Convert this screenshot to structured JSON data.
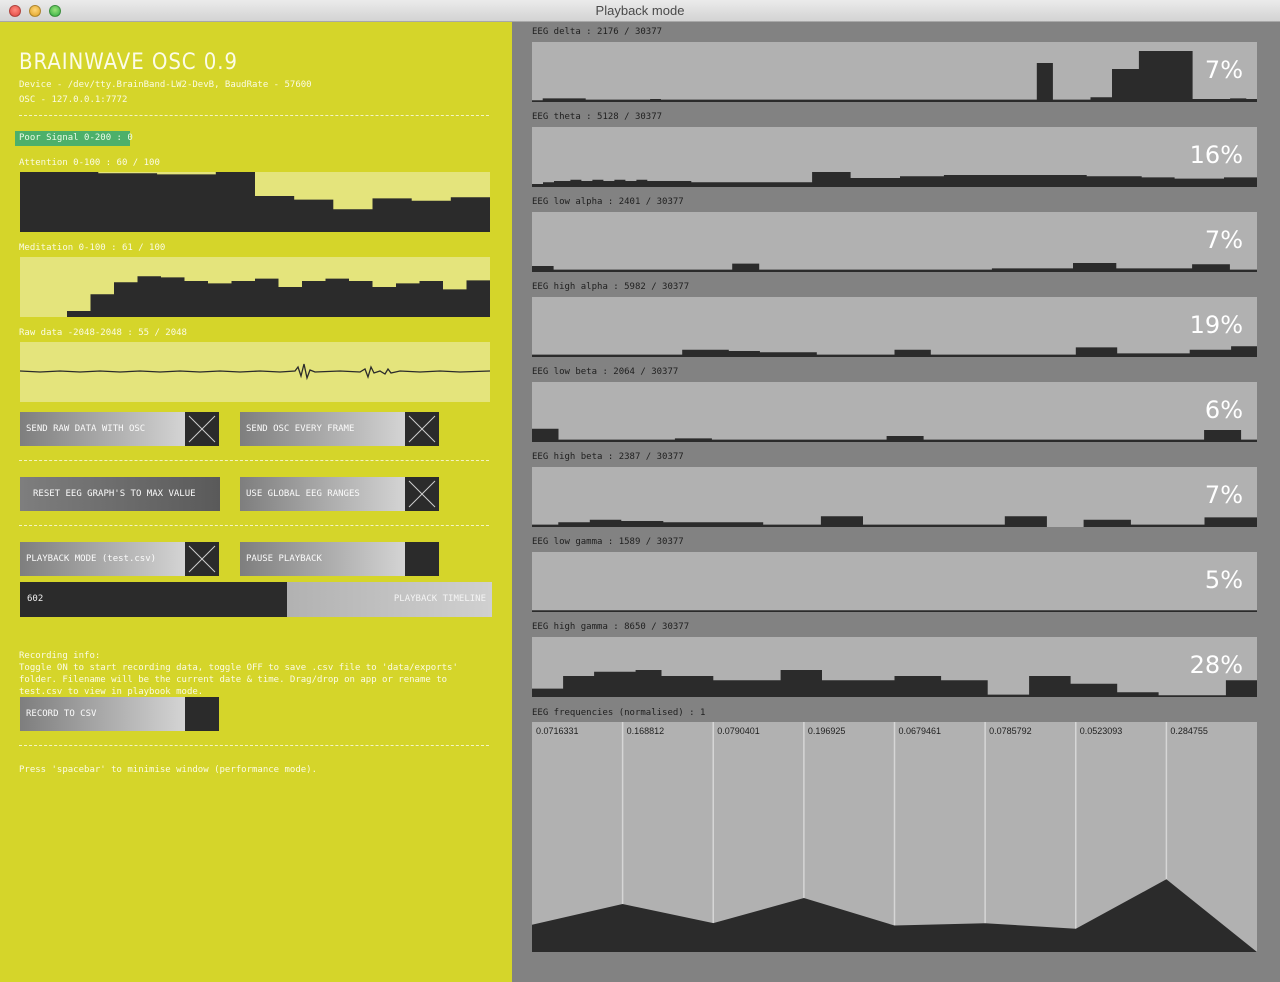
{
  "window": {
    "title": "Playback mode"
  },
  "app": {
    "title": "BRAINWAVE OSC 0.9",
    "device": "Device - /dev/tty.BrainBand-LW2-DevB, BaudRate - 57600",
    "osc": "OSC - 127.0.0.1:7772"
  },
  "poor_signal": "Poor Signal 0-200 : 0",
  "attention": {
    "label": "Attention 0-100 : 60 / 100",
    "values": [
      100,
      100,
      100,
      100,
      98,
      98,
      98,
      96,
      96,
      96,
      100,
      100,
      60,
      60,
      54,
      54,
      38,
      38,
      56,
      56,
      52,
      52,
      58,
      58
    ]
  },
  "meditation": {
    "label": "Meditation 0-100 : 61 / 100",
    "values": [
      0,
      0,
      0,
      0,
      10,
      10,
      38,
      38,
      58,
      58,
      68,
      68,
      66,
      66,
      60,
      60,
      56,
      56,
      60,
      60,
      64,
      64,
      50,
      50,
      60,
      60,
      64,
      64,
      60,
      60,
      50,
      50,
      56,
      56,
      60,
      60,
      46,
      46,
      61,
      61
    ]
  },
  "raw": {
    "label": "Raw data -2048-2048 : 55 / 2048"
  },
  "buttons": {
    "send_raw": "SEND RAW DATA WITH OSC",
    "send_every_frame": "SEND OSC EVERY FRAME",
    "reset_eeg": "RESET EEG GRAPH'S TO MAX VALUE",
    "global_ranges": "USE GLOBAL EEG RANGES",
    "playback_mode": "PLAYBACK MODE (test.csv)",
    "pause_playback": "PAUSE PLAYBACK",
    "record_csv": "RECORD TO CSV"
  },
  "toggles": {
    "send_raw": true,
    "send_every_frame": true,
    "global_ranges": true,
    "playback_mode": true,
    "pause_playback": false,
    "record_csv": false
  },
  "timeline": {
    "value": "602",
    "label": "PLAYBACK TIMELINE",
    "progress": 0.565
  },
  "recording": {
    "title": "Recording info:",
    "text": "Toggle ON to start recording data, toggle OFF to save .csv file to 'data/exports' folder. Filename will be the current date & time. Drag/drop on app or rename to test.csv to view in playbook mode."
  },
  "footer": "Press 'spacebar' to minimise window (performance mode).",
  "eeg": [
    {
      "label": "EEG delta : 2176 / 30377",
      "percent": "7%",
      "values": [
        3,
        3,
        6,
        6,
        6,
        6,
        6,
        6,
        6,
        6,
        4,
        4,
        4,
        4,
        4,
        4,
        4,
        4,
        4,
        4,
        4,
        4,
        5,
        5,
        4,
        4,
        4,
        4,
        4,
        4,
        4,
        4,
        4,
        4,
        4,
        4,
        4,
        4,
        4,
        4,
        4,
        4,
        4,
        4,
        4,
        4,
        4,
        4,
        4,
        4,
        4,
        4,
        4,
        4,
        4,
        4,
        4,
        4,
        4,
        4,
        4,
        4,
        4,
        4,
        4,
        4,
        4,
        4,
        4,
        4,
        4,
        4,
        4,
        4,
        4,
        4,
        4,
        4,
        4,
        4,
        4,
        4,
        4,
        4,
        4,
        4,
        4,
        4,
        4,
        4,
        4,
        4,
        4,
        4,
        65,
        65,
        65,
        4,
        4,
        4,
        4,
        4,
        4,
        4,
        8,
        8,
        8,
        8,
        55,
        55,
        55,
        55,
        55,
        85,
        85,
        85,
        85,
        85,
        85,
        85,
        85,
        85,
        85,
        5,
        5,
        5,
        5,
        5,
        5,
        5,
        6,
        6,
        6,
        5,
        5
      ]
    },
    {
      "label": "EEG theta : 5128 / 30377",
      "percent": "16%",
      "values": [
        5,
        5,
        8,
        8,
        10,
        10,
        10,
        12,
        12,
        10,
        10,
        12,
        12,
        10,
        10,
        12,
        12,
        10,
        10,
        12,
        12,
        10,
        10,
        10,
        10,
        10,
        10,
        10,
        10,
        8,
        8,
        8,
        8,
        8,
        8,
        8,
        8,
        8,
        8,
        8,
        8,
        8,
        8,
        8,
        8,
        8,
        8,
        8,
        8,
        8,
        8,
        25,
        25,
        25,
        25,
        25,
        25,
        25,
        15,
        15,
        15,
        15,
        15,
        15,
        15,
        15,
        15,
        18,
        18,
        18,
        18,
        18,
        18,
        18,
        18,
        20,
        20,
        20,
        20,
        20,
        20,
        20,
        20,
        20,
        20,
        20,
        20,
        20,
        20,
        20,
        20,
        20,
        20,
        20,
        20,
        20,
        20,
        20,
        20,
        20,
        20,
        18,
        18,
        18,
        18,
        18,
        18,
        18,
        18,
        18,
        18,
        16,
        16,
        16,
        16,
        16,
        16,
        14,
        14,
        14,
        14,
        14,
        14,
        14,
        14,
        14,
        16,
        16,
        16,
        16,
        16,
        16
      ]
    },
    {
      "label": "EEG low alpha : 2401 / 30377",
      "percent": "7%",
      "values": [
        10,
        10,
        10,
        10,
        4,
        4,
        4,
        4,
        4,
        4,
        4,
        4,
        4,
        4,
        4,
        4,
        4,
        4,
        4,
        4,
        4,
        4,
        4,
        4,
        4,
        4,
        4,
        4,
        4,
        4,
        4,
        4,
        4,
        4,
        4,
        4,
        4,
        14,
        14,
        14,
        14,
        14,
        4,
        4,
        4,
        4,
        4,
        4,
        4,
        4,
        4,
        4,
        4,
        4,
        4,
        4,
        4,
        4,
        4,
        4,
        4,
        4,
        4,
        4,
        4,
        4,
        4,
        4,
        4,
        4,
        4,
        4,
        4,
        4,
        4,
        4,
        4,
        4,
        4,
        4,
        4,
        4,
        4,
        4,
        4,
        6,
        6,
        6,
        6,
        6,
        6,
        6,
        6,
        6,
        6,
        6,
        6,
        6,
        6,
        6,
        15,
        15,
        15,
        15,
        15,
        15,
        15,
        15,
        6,
        6,
        6,
        6,
        6,
        6,
        6,
        6,
        6,
        6,
        6,
        6,
        6,
        6,
        13,
        13,
        13,
        13,
        13,
        13,
        13,
        4,
        4,
        4,
        4,
        4
      ]
    },
    {
      "label": "EEG high alpha : 5982 / 30377",
      "percent": "19%",
      "values": [
        4,
        4,
        4,
        4,
        4,
        4,
        4,
        4,
        4,
        4,
        4,
        4,
        4,
        4,
        4,
        4,
        4,
        4,
        4,
        4,
        4,
        4,
        4,
        4,
        4,
        4,
        4,
        4,
        4,
        12,
        12,
        12,
        12,
        12,
        12,
        12,
        12,
        12,
        10,
        10,
        10,
        10,
        10,
        10,
        8,
        8,
        8,
        8,
        8,
        8,
        8,
        8,
        8,
        8,
        8,
        4,
        4,
        4,
        4,
        4,
        4,
        4,
        4,
        4,
        4,
        4,
        4,
        4,
        4,
        4,
        12,
        12,
        12,
        12,
        12,
        12,
        12,
        4,
        4,
        4,
        4,
        4,
        4,
        4,
        4,
        4,
        4,
        4,
        4,
        4,
        4,
        4,
        4,
        4,
        4,
        4,
        4,
        4,
        4,
        4,
        4,
        4,
        4,
        4,
        4,
        16,
        16,
        16,
        16,
        16,
        16,
        16,
        16,
        6,
        6,
        6,
        6,
        6,
        6,
        6,
        6,
        6,
        6,
        6,
        6,
        6,
        6,
        12,
        12,
        12,
        12,
        12,
        12,
        12,
        12,
        18,
        18,
        18,
        18,
        18
      ]
    },
    {
      "label": "EEG low beta : 2064 / 30377",
      "percent": "6%",
      "values": [
        22,
        22,
        22,
        22,
        22,
        4,
        4,
        4,
        4,
        4,
        4,
        4,
        4,
        4,
        4,
        4,
        4,
        4,
        4,
        4,
        4,
        4,
        4,
        4,
        4,
        4,
        4,
        6,
        6,
        6,
        6,
        6,
        6,
        6,
        4,
        4,
        4,
        4,
        4,
        4,
        4,
        4,
        4,
        4,
        4,
        4,
        4,
        4,
        4,
        4,
        4,
        4,
        4,
        4,
        4,
        4,
        4,
        4,
        4,
        4,
        4,
        4,
        4,
        4,
        4,
        4,
        4,
        10,
        10,
        10,
        10,
        10,
        10,
        10,
        4,
        4,
        4,
        4,
        4,
        4,
        4,
        4,
        4,
        4,
        4,
        4,
        4,
        4,
        4,
        4,
        4,
        4,
        4,
        4,
        4,
        4,
        4,
        4,
        4,
        4,
        4,
        4,
        4,
        4,
        4,
        4,
        4,
        4,
        4,
        4,
        4,
        4,
        4,
        4,
        4,
        4,
        4,
        4,
        4,
        4,
        4,
        4,
        4,
        4,
        4,
        4,
        4,
        20,
        20,
        20,
        20,
        20,
        20,
        20,
        4,
        4,
        4
      ]
    },
    {
      "label": "EEG high beta : 2387 / 30377",
      "percent": "7%",
      "values": [
        4,
        4,
        4,
        4,
        4,
        8,
        8,
        8,
        8,
        8,
        8,
        12,
        12,
        12,
        12,
        12,
        12,
        10,
        10,
        10,
        10,
        10,
        10,
        10,
        10,
        8,
        8,
        8,
        8,
        8,
        8,
        8,
        8,
        8,
        8,
        8,
        8,
        8,
        8,
        8,
        8,
        8,
        8,
        8,
        4,
        4,
        4,
        4,
        4,
        4,
        4,
        4,
        4,
        4,
        4,
        18,
        18,
        18,
        18,
        18,
        18,
        18,
        18,
        4,
        4,
        4,
        4,
        4,
        4,
        4,
        4,
        4,
        4,
        4,
        4,
        4,
        4,
        4,
        4,
        4,
        4,
        4,
        4,
        4,
        4,
        4,
        4,
        4,
        4,
        4,
        18,
        18,
        18,
        18,
        18,
        18,
        18,
        18,
        0,
        0,
        0,
        0,
        0,
        0,
        0,
        12,
        12,
        12,
        12,
        12,
        12,
        12,
        12,
        12,
        4,
        4,
        4,
        4,
        4,
        4,
        4,
        4,
        4,
        4,
        4,
        4,
        4,
        4,
        16,
        16,
        16,
        16,
        16,
        16,
        16,
        16,
        16,
        16
      ]
    },
    {
      "label": "EEG low gamma : 1589 / 30377",
      "percent": "5%",
      "values": [
        3,
        3,
        3,
        3,
        3,
        3,
        3,
        3,
        3,
        3,
        3,
        3,
        3,
        3,
        3,
        3,
        3,
        3,
        3,
        3,
        3,
        3,
        3,
        3,
        3,
        3,
        3,
        3,
        3,
        3,
        3,
        3,
        3,
        3,
        3,
        3,
        3,
        3,
        3,
        3,
        3,
        3,
        3,
        3,
        3,
        3,
        3,
        3,
        3,
        3,
        3,
        3,
        3,
        3,
        3,
        3,
        3,
        3,
        3,
        3,
        3,
        3,
        3,
        3,
        3,
        3,
        3,
        3,
        3,
        3,
        3,
        3,
        3,
        3,
        3,
        3,
        3,
        3,
        3,
        3,
        3,
        3,
        3,
        3,
        3,
        3,
        3,
        3,
        3,
        3,
        3,
        3,
        3,
        3,
        3,
        3,
        3,
        3,
        3,
        3,
        3,
        3,
        3,
        3,
        3,
        3,
        3,
        3,
        3,
        3,
        3,
        3,
        3,
        3,
        3,
        3,
        3,
        3,
        3,
        3,
        3,
        3,
        3,
        3,
        3,
        3,
        3,
        3,
        3,
        3,
        3,
        3,
        3,
        3,
        3,
        3,
        3,
        3,
        3,
        3
      ]
    },
    {
      "label": "EEG high gamma : 8650 / 30377",
      "percent": "28%",
      "values": [
        14,
        14,
        14,
        14,
        14,
        14,
        35,
        35,
        35,
        35,
        35,
        35,
        42,
        42,
        42,
        42,
        42,
        42,
        42,
        42,
        45,
        45,
        45,
        45,
        45,
        35,
        35,
        35,
        35,
        35,
        35,
        35,
        35,
        35,
        35,
        28,
        28,
        28,
        28,
        28,
        28,
        28,
        28,
        28,
        28,
        28,
        28,
        28,
        45,
        45,
        45,
        45,
        45,
        45,
        45,
        45,
        28,
        28,
        28,
        28,
        28,
        28,
        28,
        28,
        28,
        28,
        28,
        28,
        28,
        28,
        35,
        35,
        35,
        35,
        35,
        35,
        35,
        35,
        35,
        28,
        28,
        28,
        28,
        28,
        28,
        28,
        28,
        28,
        4,
        4,
        4,
        4,
        4,
        4,
        4,
        4,
        35,
        35,
        35,
        35,
        35,
        35,
        35,
        35,
        22,
        22,
        22,
        22,
        22,
        22,
        22,
        22,
        22,
        8,
        8,
        8,
        8,
        8,
        8,
        8,
        8,
        3,
        3,
        3,
        3,
        3,
        3,
        3,
        3,
        3,
        3,
        3,
        3,
        3,
        28,
        28,
        28,
        28,
        28,
        28
      ]
    }
  ],
  "freq": {
    "label": "EEG frequencies (normalised) : 1",
    "values": [
      "0.0716331",
      "0.168812",
      "0.0790401",
      "0.196925",
      "0.0679461",
      "0.0785792",
      "0.0523093",
      "0.284755"
    ]
  },
  "chart_data": {
    "type": "area",
    "title": "EEG frequencies (normalised) : 1",
    "x": [
      "1",
      "2",
      "3",
      "4",
      "5",
      "6",
      "7",
      "8"
    ],
    "values": [
      0.0716331,
      0.168812,
      0.0790401,
      0.196925,
      0.0679461,
      0.0785792,
      0.0523093,
      0.284755
    ],
    "ylim": [
      0,
      1
    ]
  },
  "colors": {
    "left_bg": "#d5d52a",
    "right_bg": "#828282",
    "graph_dark": "#2b2b2b",
    "signal_badge": "#4cb06a"
  }
}
